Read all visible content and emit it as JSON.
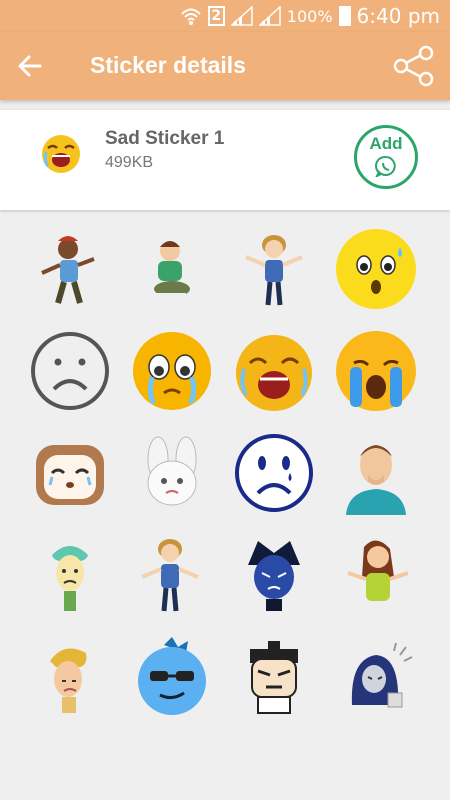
{
  "status_bar": {
    "sim_slot": "2",
    "battery": "100%",
    "time": "6:40 pm"
  },
  "app_bar": {
    "title": "Sticker details"
  },
  "pack": {
    "name": "Sad Sticker 1",
    "size": "499KB",
    "add_label": "Add"
  },
  "stickers": [
    {
      "icon": "boy-cap-walking"
    },
    {
      "icon": "boy-sitting-sad"
    },
    {
      "icon": "woman-shrugging"
    },
    {
      "icon": "worried-face"
    },
    {
      "icon": "frowning-outline-face"
    },
    {
      "icon": "crying-tears-face"
    },
    {
      "icon": "screaming-crying-face"
    },
    {
      "icon": "loudly-crying-face"
    },
    {
      "icon": "sad-cat-face"
    },
    {
      "icon": "sad-bunny"
    },
    {
      "icon": "blue-sad-face-tear"
    },
    {
      "icon": "man-hand-on-mouth"
    },
    {
      "icon": "sad-green-hair-boy"
    },
    {
      "icon": "woman-shrugging-2"
    },
    {
      "icon": "blue-anime-boy"
    },
    {
      "icon": "girl-shrugging"
    },
    {
      "icon": "sad-blond-boy"
    },
    {
      "icon": "blue-cool-face"
    },
    {
      "icon": "angry-cartoon-boy"
    },
    {
      "icon": "hooded-sad-figure"
    }
  ]
}
